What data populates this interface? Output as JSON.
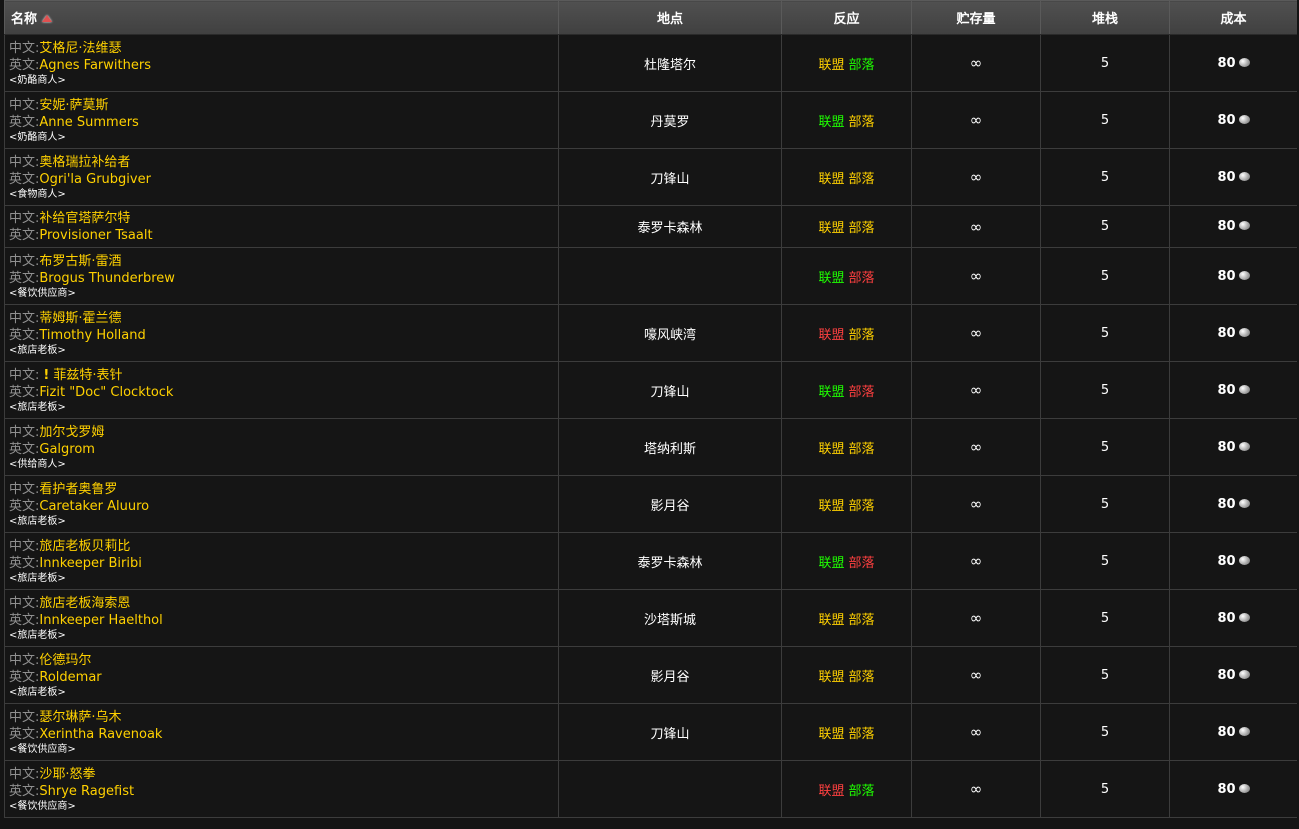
{
  "columns": {
    "name": "名称",
    "location": "地点",
    "reaction": "反应",
    "stock": "贮存量",
    "stack": "堆栈",
    "cost": "成本"
  },
  "labels": {
    "cn": "中文:",
    "en": "英文:"
  },
  "colors": {
    "name_text": "#ffd100",
    "label_gray": "#909090",
    "friendly": "#ffd100",
    "allied": "#1eff00",
    "hostile": "#ff4040"
  },
  "rows": [
    {
      "cn": "艾格尼·法维瑟",
      "en": "Agnes Farwithers",
      "title": "<奶酪商人>",
      "location": "杜隆塔尔",
      "alliance": "联盟",
      "alliance_color": "yellow",
      "horde": "部落",
      "horde_color": "green",
      "stock": "∞",
      "stack": "5",
      "cost": "80",
      "quest": "",
      "coin_icon": "silver-coin-icon"
    },
    {
      "cn": "安妮·萨莫斯",
      "en": "Anne Summers",
      "title": "<奶酪商人>",
      "location": "丹莫罗",
      "alliance": "联盟",
      "alliance_color": "green",
      "horde": "部落",
      "horde_color": "yellow",
      "stock": "∞",
      "stack": "5",
      "cost": "80",
      "quest": "",
      "coin_icon": "silver-coin-icon"
    },
    {
      "cn": "奥格瑞拉补给者",
      "en": "Ogri'la Grubgiver",
      "title": "<食物商人>",
      "location": "刀锋山",
      "alliance": "联盟",
      "alliance_color": "yellow",
      "horde": "部落",
      "horde_color": "yellow",
      "stock": "∞",
      "stack": "5",
      "cost": "80",
      "quest": "",
      "coin_icon": "silver-coin-icon"
    },
    {
      "cn": "补给官塔萨尔特",
      "en": "Provisioner Tsaalt",
      "title": "",
      "location": "泰罗卡森林",
      "alliance": "联盟",
      "alliance_color": "yellow",
      "horde": "部落",
      "horde_color": "yellow",
      "stock": "∞",
      "stack": "5",
      "cost": "80",
      "quest": "",
      "coin_icon": "silver-coin-icon"
    },
    {
      "cn": "布罗古斯·雷酒",
      "en": "Brogus Thunderbrew",
      "title": "<餐饮供应商>",
      "location": "",
      "alliance": "联盟",
      "alliance_color": "green",
      "horde": "部落",
      "horde_color": "red",
      "stock": "∞",
      "stack": "5",
      "cost": "80",
      "quest": "",
      "coin_icon": "silver-coin-icon"
    },
    {
      "cn": "蒂姆斯·霍兰德",
      "en": "Timothy Holland",
      "title": "<旅店老板>",
      "location": "嚎风峡湾",
      "alliance": "联盟",
      "alliance_color": "red",
      "horde": "部落",
      "horde_color": "yellow",
      "stock": "∞",
      "stack": "5",
      "cost": "80",
      "quest": "",
      "coin_icon": "silver-coin-icon"
    },
    {
      "cn": "菲兹特·表针",
      "en": "Fizit \"Doc\" Clocktock",
      "title": "<旅店老板>",
      "location": "刀锋山",
      "alliance": "联盟",
      "alliance_color": "green",
      "horde": "部落",
      "horde_color": "red",
      "stock": "∞",
      "stack": "5",
      "cost": "80",
      "quest": "!",
      "coin_icon": "silver-coin-icon"
    },
    {
      "cn": "加尔戈罗姆",
      "en": "Galgrom",
      "title": "<供给商人>",
      "location": "塔纳利斯",
      "alliance": "联盟",
      "alliance_color": "yellow",
      "horde": "部落",
      "horde_color": "yellow",
      "stock": "∞",
      "stack": "5",
      "cost": "80",
      "quest": "",
      "coin_icon": "silver-coin-icon"
    },
    {
      "cn": "看护者奥鲁罗",
      "en": "Caretaker Aluuro",
      "title": "<旅店老板>",
      "location": "影月谷",
      "alliance": "联盟",
      "alliance_color": "yellow",
      "horde": "部落",
      "horde_color": "yellow",
      "stock": "∞",
      "stack": "5",
      "cost": "80",
      "quest": "",
      "coin_icon": "silver-coin-icon"
    },
    {
      "cn": "旅店老板贝莉比",
      "en": "Innkeeper Biribi",
      "title": "<旅店老板>",
      "location": "泰罗卡森林",
      "alliance": "联盟",
      "alliance_color": "green",
      "horde": "部落",
      "horde_color": "red",
      "stock": "∞",
      "stack": "5",
      "cost": "80",
      "quest": "",
      "coin_icon": "silver-coin-icon"
    },
    {
      "cn": "旅店老板海索恩",
      "en": "Innkeeper Haelthol",
      "title": "<旅店老板>",
      "location": "沙塔斯城",
      "alliance": "联盟",
      "alliance_color": "yellow",
      "horde": "部落",
      "horde_color": "yellow",
      "stock": "∞",
      "stack": "5",
      "cost": "80",
      "quest": "",
      "coin_icon": "silver-coin-icon"
    },
    {
      "cn": "伦德玛尔",
      "en": "Roldemar",
      "title": "<旅店老板>",
      "location": "影月谷",
      "alliance": "联盟",
      "alliance_color": "yellow",
      "horde": "部落",
      "horde_color": "yellow",
      "stock": "∞",
      "stack": "5",
      "cost": "80",
      "quest": "",
      "coin_icon": "silver-coin-icon"
    },
    {
      "cn": "瑟尔琳萨·乌木",
      "en": "Xerintha Ravenoak",
      "title": "<餐饮供应商>",
      "location": "刀锋山",
      "alliance": "联盟",
      "alliance_color": "yellow",
      "horde": "部落",
      "horde_color": "yellow",
      "stock": "∞",
      "stack": "5",
      "cost": "80",
      "quest": "",
      "coin_icon": "silver-coin-icon"
    },
    {
      "cn": "沙耶·怒拳",
      "en": "Shrye Ragefist",
      "title": "<餐饮供应商>",
      "location": "",
      "alliance": "联盟",
      "alliance_color": "red",
      "horde": "部落",
      "horde_color": "green",
      "stock": "∞",
      "stack": "5",
      "cost": "80",
      "quest": "",
      "coin_icon": "silver-coin-icon"
    }
  ]
}
